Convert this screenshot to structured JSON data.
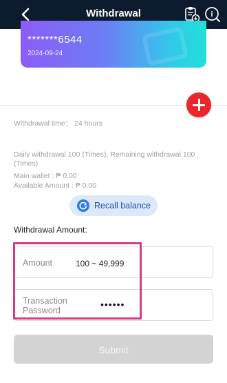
{
  "header": {
    "title": "Withdrawal",
    "back_icon": "chevron-left-icon",
    "records_icon": "clipboard-icon",
    "help_icon": "help-icon"
  },
  "card": {
    "number": "*******6544",
    "date": "2024-09-24"
  },
  "info": {
    "withdrawal_time_label": "Withdrawal time：",
    "withdrawal_time_value": "24 hours",
    "daily_limit": "Daily withdrawal 100 (Times), Remaining withdrawal 100 (Times)",
    "main_wallet": "Main wallet : ₱ 0.00",
    "available_amount": "Available Amount : ₱ 0.00"
  },
  "recall": {
    "label": "Recall balance"
  },
  "form": {
    "section_title": "Withdrawal Amount:",
    "amount_label": "Amount",
    "amount_range": "100 ~ 49,999",
    "password_label": "Transaction Password",
    "password_value": "••••••"
  },
  "submit": {
    "label": "Submit"
  },
  "colors": {
    "header_bg": "#0d1b2e",
    "add_button": "#e8262b",
    "highlight": "#d63a84",
    "recall_bg": "#dbe9fb"
  }
}
